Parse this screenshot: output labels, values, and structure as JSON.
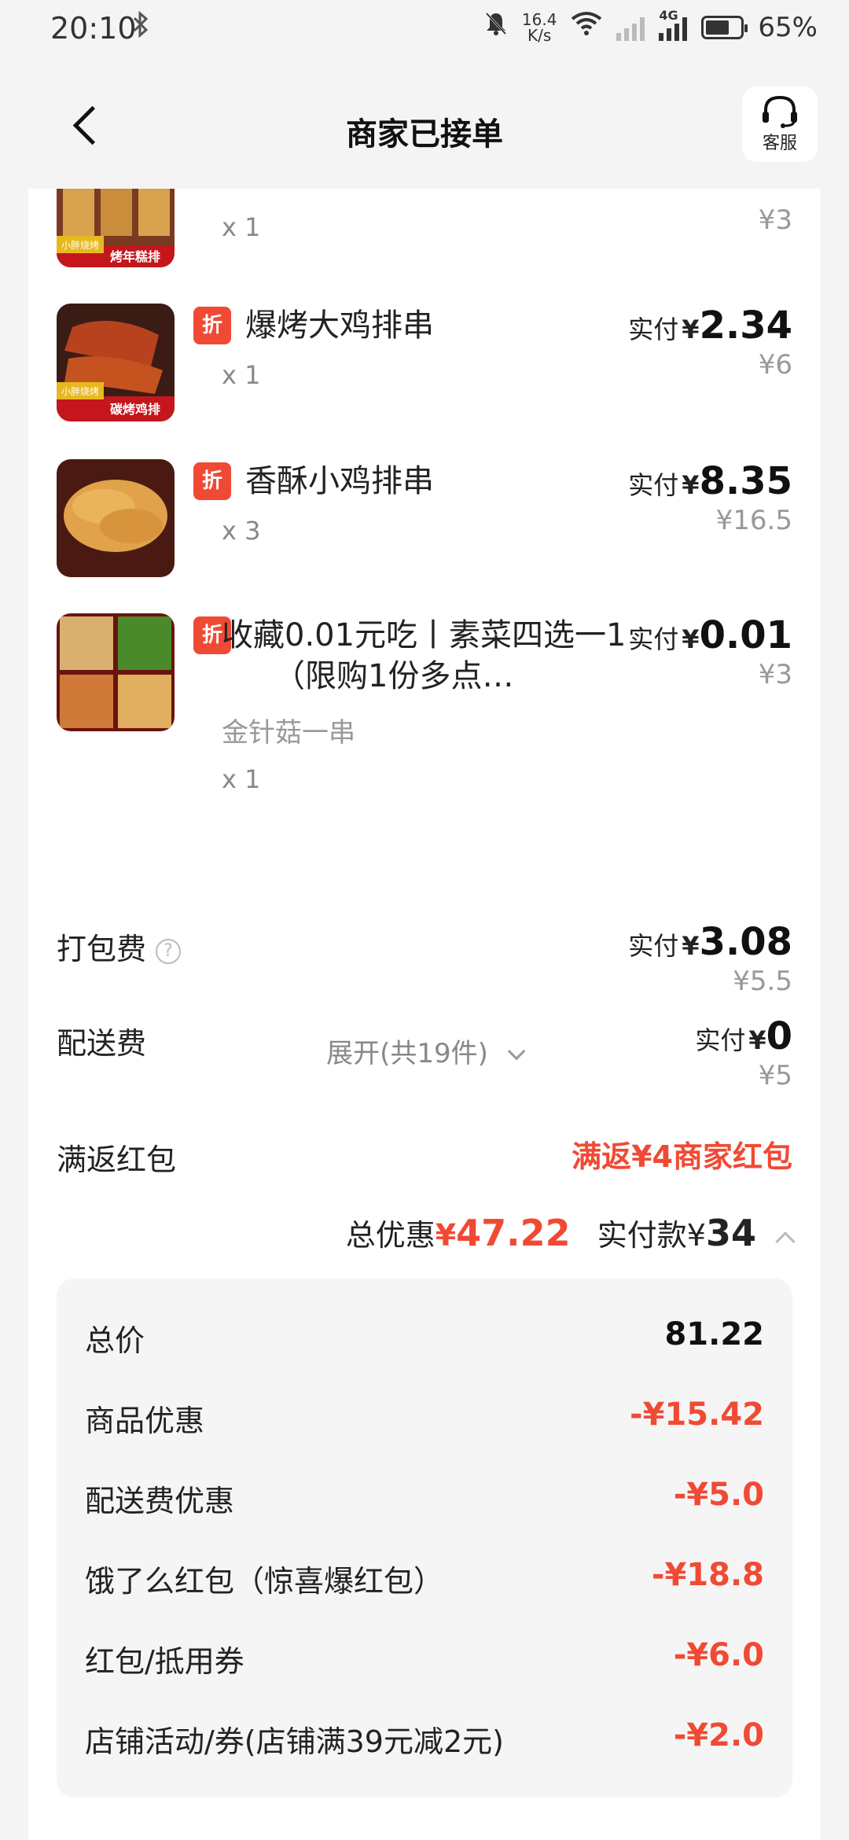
{
  "status": {
    "time": "20:10",
    "bluetooth_icon": "bluetooth-icon",
    "net_speed_top": "16.4",
    "net_speed_bottom": "K/s",
    "network": "4G",
    "battery": "65%"
  },
  "nav": {
    "title": "商家已接单",
    "service_label": "客服"
  },
  "items": [
    {
      "qty": "x 1",
      "orig": "¥3"
    },
    {
      "tag": "折",
      "name": "爆烤大鸡排串",
      "qty": "x 1",
      "paid_label": "实付",
      "currency": "¥",
      "paid": "2.34",
      "orig": "¥6"
    },
    {
      "tag": "折",
      "name": "香酥小鸡排串",
      "qty": "x 3",
      "paid_label": "实付",
      "currency": "¥",
      "paid": "8.35",
      "orig": "¥16.5"
    },
    {
      "tag": "折",
      "name": "收藏0.01元吃丨素菜四选一1（限购1份多点…",
      "spec": "金针菇一串",
      "qty": "x 1",
      "paid_label": "实付",
      "currency": "¥",
      "paid": "0.01",
      "orig": "¥3"
    }
  ],
  "expand_label": "展开(共19件)",
  "fees": {
    "packing_label": "打包费",
    "packing_paid_label": "实付",
    "packing_currency": "¥",
    "packing_paid": "3.08",
    "packing_orig": "¥5.5",
    "delivery_label": "配送费",
    "delivery_paid_label": "实付",
    "delivery_currency": "¥",
    "delivery_paid": "0",
    "delivery_orig": "¥5"
  },
  "hongbao": {
    "label": "满返红包",
    "value": "满返¥4商家红包"
  },
  "summary": {
    "discount_label": "总优惠",
    "discount_currency": "¥",
    "discount_value": "47.22",
    "paid_label": "实付款",
    "paid_currency": "¥",
    "paid_value": "34"
  },
  "breakdown": [
    {
      "label": "总价",
      "value": "81.22"
    },
    {
      "label": "商品优惠",
      "value": "-¥15.42"
    },
    {
      "label": "配送费优惠",
      "value": "-¥5.0"
    },
    {
      "label": "饿了么红包（惊喜爆红包）",
      "value": "-¥18.8"
    },
    {
      "label": "红包/抵用券",
      "value": "-¥6.0"
    },
    {
      "label": "店铺活动/券(店铺满39元减2元)",
      "value": "-¥2.0"
    }
  ],
  "thumb_captions": [
    "小胖烧烤",
    "烤年糕排",
    "碳烤鸡排"
  ],
  "colors": {
    "accent_red": "#f04a34",
    "background": "#f4f4f4"
  }
}
